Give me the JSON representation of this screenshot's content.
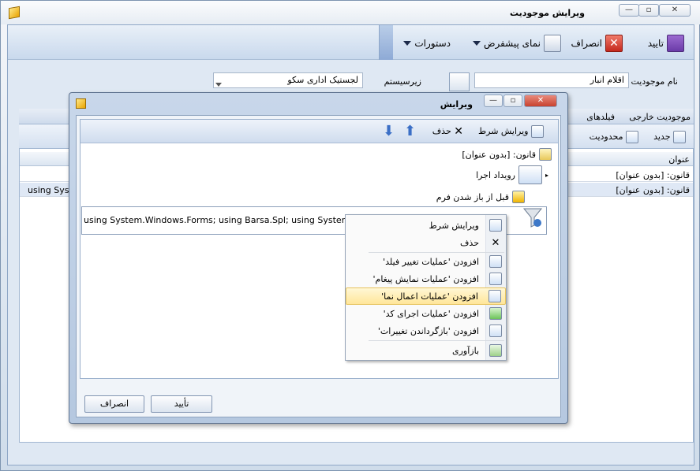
{
  "window": {
    "title": "ویرایش موجودیت"
  },
  "toolbar": {
    "confirm": "تایید",
    "cancel": "انصراف",
    "default_view": "نمای پیشفرض",
    "commands": "دستورات"
  },
  "form": {
    "entity_name_label": "نام موجودیت",
    "entity_name_value": "اقلام انبار",
    "subsystem_label": "زیرسیستم",
    "subsystem_value": "لجستیک اداری سکو"
  },
  "tabs": {
    "foreign_entity": "موجودیت خارجی",
    "fields": "فیلدهای"
  },
  "bg_toolbar": {
    "new": "جدید",
    "restriction": "محدودیت"
  },
  "bg_grid": {
    "column_title": "عنوان",
    "rows": [
      "قانون: [بدون عنوان]",
      "قانون: [بدون عنوان]"
    ],
    "left_text": "using Sys..."
  },
  "dialog": {
    "title": "ویرایش",
    "edit_condition": "ویرایش شرط",
    "delete": "حذف",
    "tree": {
      "rule": "قانون: [بدون عنوان]",
      "event": "رویداد اجرا",
      "before_open": "قبل از باز شدن فرم",
      "code": "using System.Windows.Forms; using Barsa.Spl; using System; using"
    },
    "ok": "تأیید",
    "cancel": "انصراف"
  },
  "context_menu": {
    "items": [
      "ویرایش شرط",
      "حذف",
      "افزودن 'عملیات تغییر فیلد'",
      "افزودن 'عملیات نمایش پیغام'",
      "افزودن 'عملیات اعمال نما'",
      "افزودن 'عملیات اجرای کد'",
      "افزودن 'بازگرداندن تغییرات'",
      "بازآوری"
    ],
    "highlighted_index": 4
  },
  "colors": {
    "accent": "#4a76c0",
    "highlight": "#ffe69a"
  }
}
